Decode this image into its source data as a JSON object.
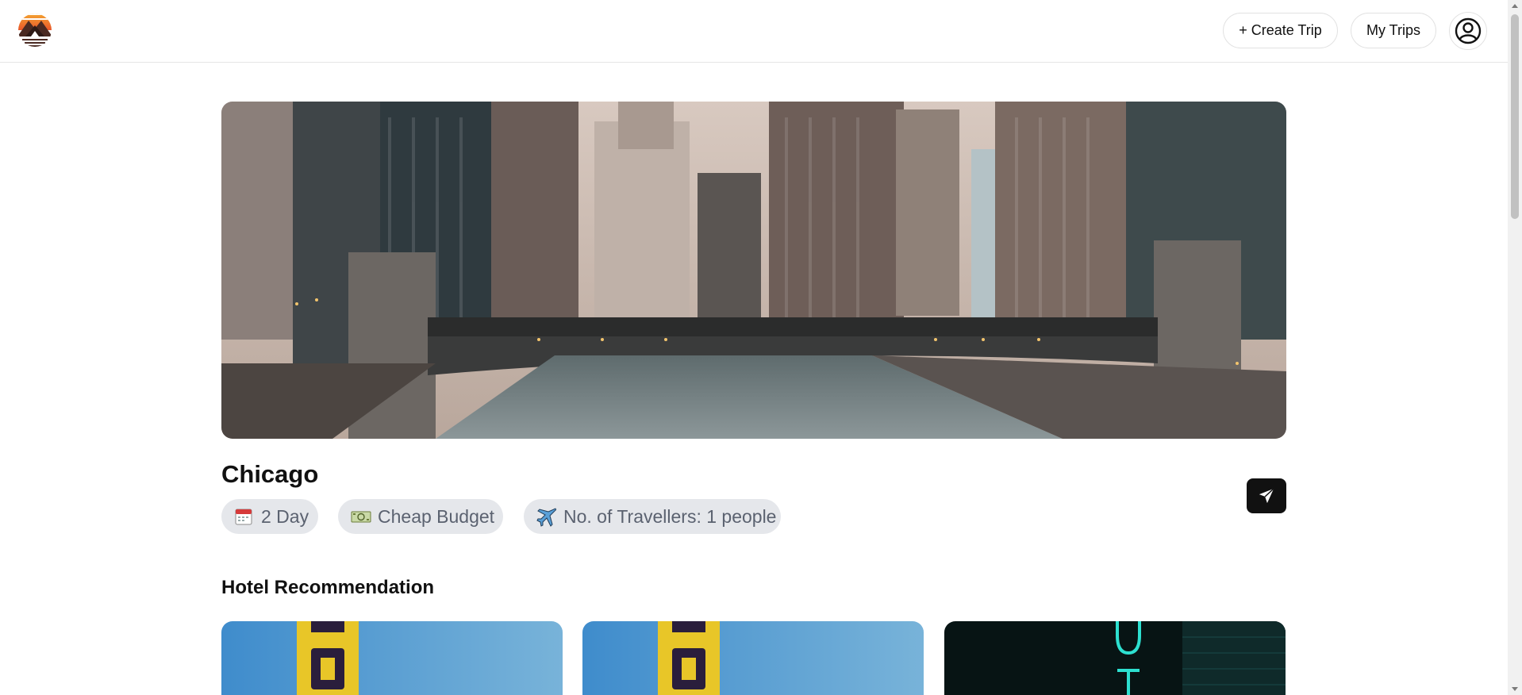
{
  "header": {
    "logo_icon": "sunset-mountain-logo-icon",
    "create_trip_label": "+ Create Trip",
    "my_trips_label": "My Trips",
    "profile_icon": "user-circle-icon"
  },
  "trip": {
    "hero_image": "chicago-river-skyline-photo",
    "destination": "Chicago",
    "days_label": "2 Day",
    "days_icon": "calendar-icon",
    "budget_label": "Cheap Budget",
    "budget_icon": "money-icon",
    "travellers_label": "No. of Travellers: 1 people",
    "travellers_icon": "airplane-icon",
    "share_icon": "send-icon"
  },
  "hotels": {
    "section_title": "Hotel Recommendation",
    "cards": [
      {
        "image": "motel-sign-photo"
      },
      {
        "image": "motel-sign-photo"
      },
      {
        "image": "neon-hotel-sign-photo"
      }
    ]
  },
  "colors": {
    "chip_bg": "#e5e7eb",
    "chip_text": "#5b6270",
    "share_bg": "#111111"
  }
}
